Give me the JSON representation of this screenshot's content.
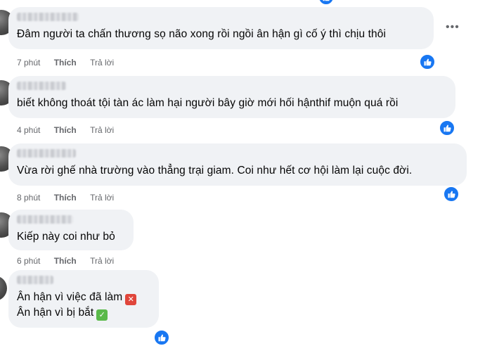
{
  "comments": [
    {
      "text": "Đâm người ta chấn thương sọ não xong rồi ngồi ân hận gì cố ý thì chịu thôi",
      "time": "7 phút",
      "like": "Thích",
      "reply": "Trả lời"
    },
    {
      "text": "biết không thoát tội tàn ác làm hại người bây giờ mới hối hậnthif muộn quá rồi",
      "time": "4 phút",
      "like": "Thích",
      "reply": "Trả lời"
    },
    {
      "text": "Vừa rời ghế nhà trường vào thẳng trại giam. Coi như hết cơ hội làm lại cuộc đời.",
      "time": "8 phút",
      "like": "Thích",
      "reply": "Trả lời"
    },
    {
      "text": "Kiếp này coi như bỏ",
      "time": "6 phút",
      "like": "Thích",
      "reply": "Trả lời"
    },
    {
      "line1": "Ân hận vì việc đã làm",
      "line2": "Ân hận vì bị bắt"
    }
  ],
  "icons": {
    "more": "more-options-icon",
    "reaction": "like-reaction-icon",
    "wrong": "cross-mark-icon",
    "right": "check-mark-icon"
  },
  "colors": {
    "bubble": "#f0f2f5",
    "accent": "#1877f2",
    "meta": "#65676b"
  }
}
